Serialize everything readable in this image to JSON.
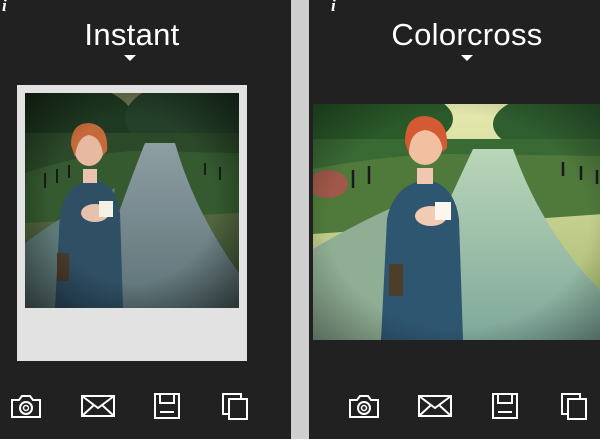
{
  "screens": [
    {
      "filter_name": "Instant",
      "info_glyph": "i",
      "frame_style": "polaroid",
      "colors": {
        "sky": "#7c8a5c",
        "trees": "#2c4a2a",
        "road": "#6f8a8e",
        "coat": "#2f4f64",
        "hair": "#c56a3a",
        "frame": "#e2e2e2"
      }
    },
    {
      "filter_name": "Colorcross",
      "info_glyph": "i",
      "frame_style": "full-bleed",
      "colors": {
        "sky": "#d7e0a0",
        "trees": "#2f5a2a",
        "road": "#8ab5a6",
        "coat": "#2e5670",
        "hair": "#d45a34",
        "frame": "none"
      }
    }
  ],
  "toolbar": {
    "icons": [
      "camera-icon",
      "mail-icon",
      "save-icon",
      "copy-icon"
    ]
  },
  "theme": {
    "background": "#212121",
    "text": "#ffffff",
    "divider": "#cfcfcf"
  }
}
